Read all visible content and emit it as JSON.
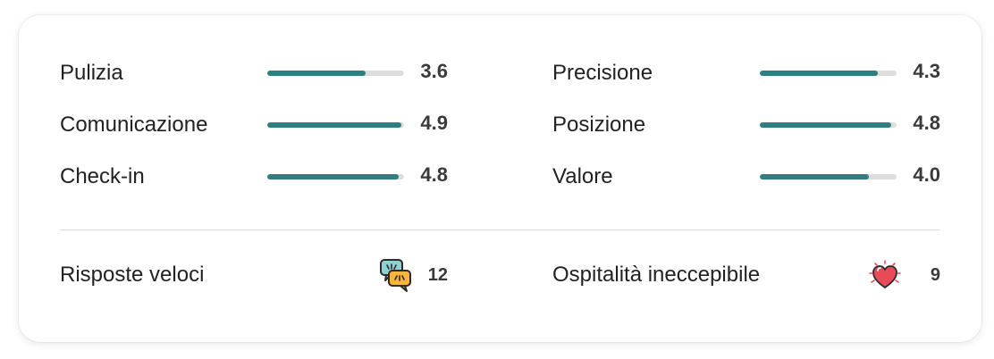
{
  "ratings": {
    "left": [
      {
        "label": "Pulizia",
        "value": "3.6",
        "fraction": 0.72
      },
      {
        "label": "Comunicazione",
        "value": "4.9",
        "fraction": 0.98
      },
      {
        "label": "Check-in",
        "value": "4.8",
        "fraction": 0.96
      }
    ],
    "right": [
      {
        "label": "Precisione",
        "value": "4.3",
        "fraction": 0.86
      },
      {
        "label": "Posizione",
        "value": "4.8",
        "fraction": 0.96
      },
      {
        "label": "Valore",
        "value": "4.0",
        "fraction": 0.8
      }
    ]
  },
  "highlights": [
    {
      "label": "Risposte veloci",
      "count": "12",
      "icon": "speech-bubbles-icon"
    },
    {
      "label": "Ospitalità ineccepibile",
      "count": "9",
      "icon": "sparkling-heart-icon"
    }
  ],
  "colors": {
    "bar_fill": "#2f7f80",
    "bar_track": "#dddddd",
    "text": "#222222",
    "divider": "#dddddd"
  }
}
